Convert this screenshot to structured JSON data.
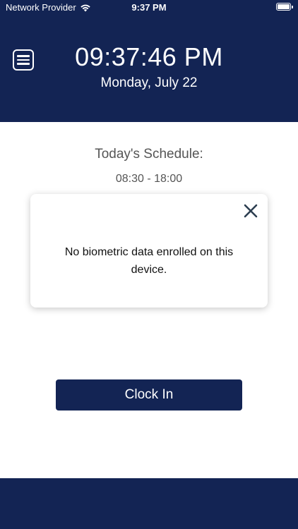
{
  "status_bar": {
    "carrier": "Network Provider",
    "time": "9:37 PM",
    "wifi_icon": "wifi-icon",
    "battery_icon": "battery-icon"
  },
  "header": {
    "menu_icon": "hamburger-menu-icon",
    "time": "09:37:46 PM",
    "date": "Monday, July 22"
  },
  "schedule": {
    "title": "Today's Schedule:",
    "hours": "08:30 - 18:00"
  },
  "dialog": {
    "message": "No biometric data enrolled on this device.",
    "close_icon": "close-icon"
  },
  "actions": {
    "clock_in_label": "Clock In"
  },
  "colors": {
    "primary": "#132454",
    "background": "#ffffff",
    "text_muted": "#555555"
  }
}
